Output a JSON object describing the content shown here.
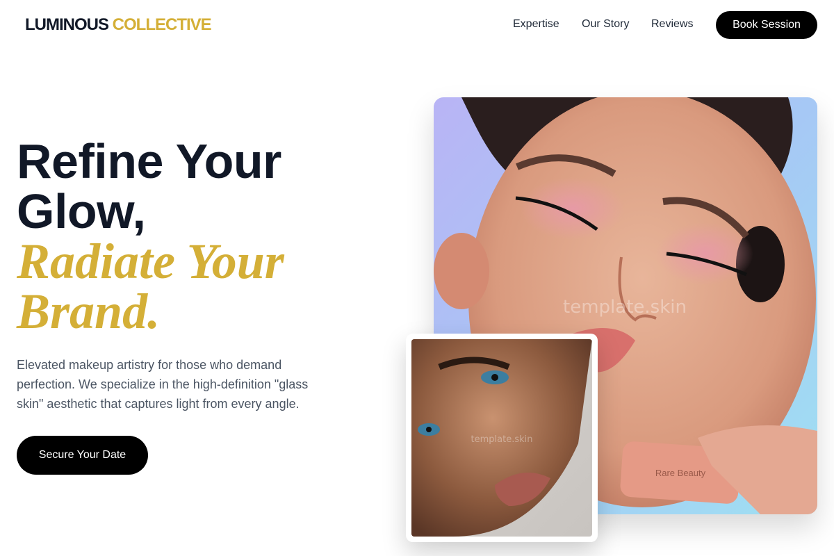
{
  "brand": {
    "part1": "LUMINOUS",
    "part2": "COLLECTIVE"
  },
  "nav": {
    "links": [
      "Expertise",
      "Our Story",
      "Reviews"
    ],
    "cta": "Book Session"
  },
  "hero": {
    "headline_line1": "Refine Your",
    "headline_line2": "Glow,",
    "headline_accent_line1": "Radiate Your",
    "headline_accent_line2": "Brand.",
    "subtitle": "Elevated makeup artistry for those who demand perfection. We specialize in the high-definition \"glass skin\" aesthetic that captures light from every angle.",
    "cta": "Secure Your Date"
  },
  "images": {
    "watermark": "template.skin",
    "product_label": "Rare Beauty"
  },
  "colors": {
    "accent": "#d4af37",
    "text": "#111827",
    "muted": "#4b5563",
    "button": "#000000"
  }
}
